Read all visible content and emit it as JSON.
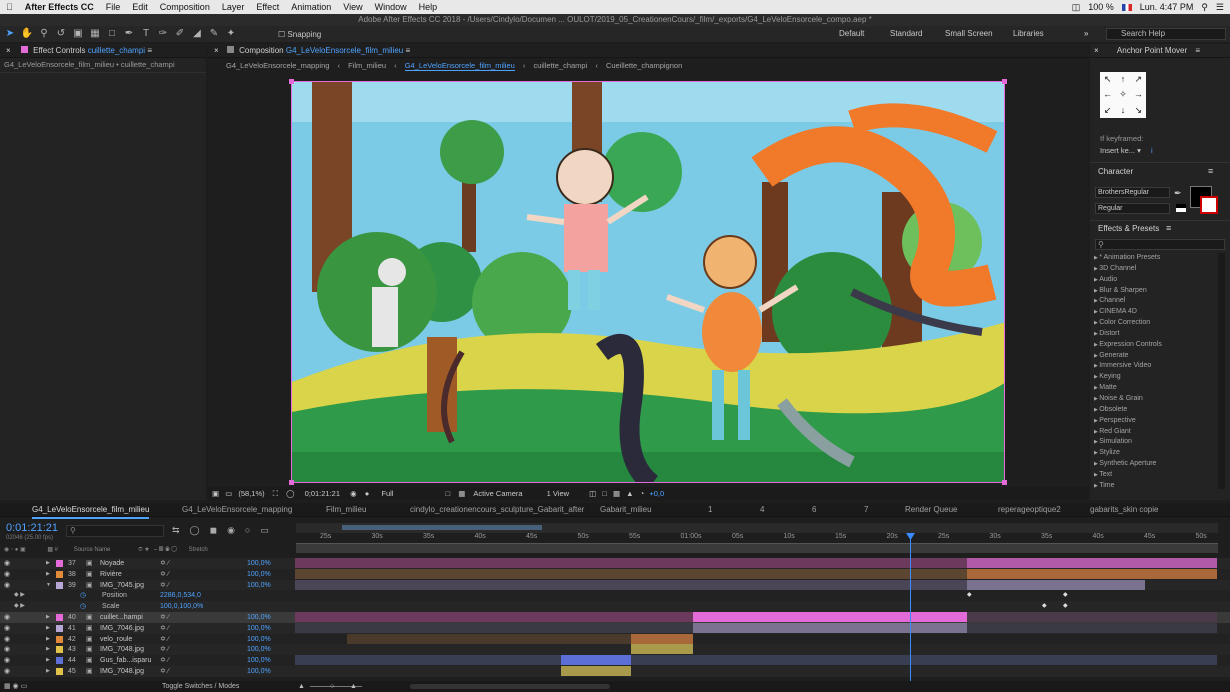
{
  "menubar": {
    "app": "After Effects CC",
    "items": [
      "File",
      "Edit",
      "Composition",
      "Layer",
      "Effect",
      "Animation",
      "View",
      "Window",
      "Help"
    ],
    "battery": "100 %",
    "clock": "Lun. 4:47 PM"
  },
  "titlebar": {
    "text": "Adobe After Effects CC 2018 - /Users/Cindylo/Documen ... OULOT/2019_05_CreationenCours/_film/_exports/G4_LeVeloEnsorcele_compo.aep *"
  },
  "toolbar": {
    "snapping": "Snapping",
    "workspaces": [
      "Default",
      "Standard",
      "Small Screen",
      "Libraries"
    ],
    "search": "Search Help"
  },
  "effect_controls": {
    "tab_prefix": "Effect Controls",
    "tab_layer": "cuillette_champi",
    "subtitle": "G4_LeVeloEnsorcele_film_milieu • cuillette_champi"
  },
  "composition": {
    "tab_prefix": "Composition",
    "tab_name": "G4_LeVeloEnsorcele_film_milieu",
    "breadcrumbs": [
      "G4_LeVeloEnsorcele_mapping",
      "Film_milieu",
      "G4_LeVeloEnsorcele_film_milieu",
      "cuillette_champi",
      "Cueillette_champignon"
    ],
    "zoom": "(58,1%)",
    "timecode": "0;01:21:21",
    "resolution": "Full",
    "camera": "Active Camera",
    "views": "1 View",
    "exposure": "+0,0"
  },
  "anchor_point_mover": {
    "title": "Anchor Point Mover",
    "if_keyframed": "If keyframed:",
    "insert_key": "Insert ke...",
    "info": "i"
  },
  "character": {
    "title": "Character",
    "font": "BrothersRegular",
    "style": "Regular"
  },
  "effects_presets": {
    "title": "Effects & Presets",
    "search_placeholder": "",
    "items": [
      "* Animation Presets",
      "3D Channel",
      "Audio",
      "Blur & Sharpen",
      "Channel",
      "CINEMA 4D",
      "Color Correction",
      "Distort",
      "Expression Controls",
      "Generate",
      "Immersive Video",
      "Keying",
      "Matte",
      "Noise & Grain",
      "Obsolete",
      "Perspective",
      "Red Giant",
      "Simulation",
      "Stylize",
      "Synthetic Aperture",
      "Text",
      "Time"
    ]
  },
  "timeline": {
    "tabs": [
      "G4_LeVeloEnsorcele_film_milieu",
      "G4_LeVeloEnsorcele_mapping",
      "Film_milieu",
      "cindylo_creationencours_sculpture_Gabarit_after",
      "Gabarit_milieu",
      "1",
      "4",
      "6",
      "7",
      "Render Queue",
      "reperageoptique2",
      "gabarits_skin copie"
    ],
    "timecode": "0:01:21:21",
    "fps": "02046 (25.00 fps)",
    "col_source": "Source Name",
    "col_stretch": "Stretch",
    "ruler": [
      "25s",
      "30s",
      "35s",
      "40s",
      "45s",
      "50s",
      "55s",
      "01:00s",
      "05s",
      "10s",
      "15s",
      "20s",
      "25s",
      "30s",
      "35s",
      "40s",
      "45s",
      "50s"
    ],
    "layers": [
      {
        "num": "37",
        "name": "Noyade",
        "stretch": "100,0%",
        "color": "#e26bd8"
      },
      {
        "num": "38",
        "name": "Rivière",
        "stretch": "100,0%",
        "color": "#e08a3a"
      },
      {
        "num": "39",
        "name": "IMG_7045.jpg",
        "stretch": "100,0%",
        "color": "#b7a7d6"
      },
      {
        "num": "",
        "name": "Position",
        "stretch": "2286,0,534,0",
        "color": ""
      },
      {
        "num": "",
        "name": "Scale",
        "stretch": "100,0,100,0%",
        "color": ""
      },
      {
        "num": "40",
        "name": "cuillet...hampi",
        "stretch": "100,0%",
        "color": "#e26bd8"
      },
      {
        "num": "41",
        "name": "IMG_7046.jpg",
        "stretch": "100,0%",
        "color": "#b7a7d6"
      },
      {
        "num": "42",
        "name": "velo_roule",
        "stretch": "100,0%",
        "color": "#e08a3a"
      },
      {
        "num": "43",
        "name": "IMG_7048.jpg",
        "stretch": "100,0%",
        "color": "#e3c24a"
      },
      {
        "num": "44",
        "name": "Gus_fab...isparu",
        "stretch": "100,0%",
        "color": "#5b6fd6"
      },
      {
        "num": "45",
        "name": "IMG_7048.jpg",
        "stretch": "100,0%",
        "color": "#e3c24a"
      }
    ],
    "toggle_label": "Toggle Switches / Modes"
  }
}
